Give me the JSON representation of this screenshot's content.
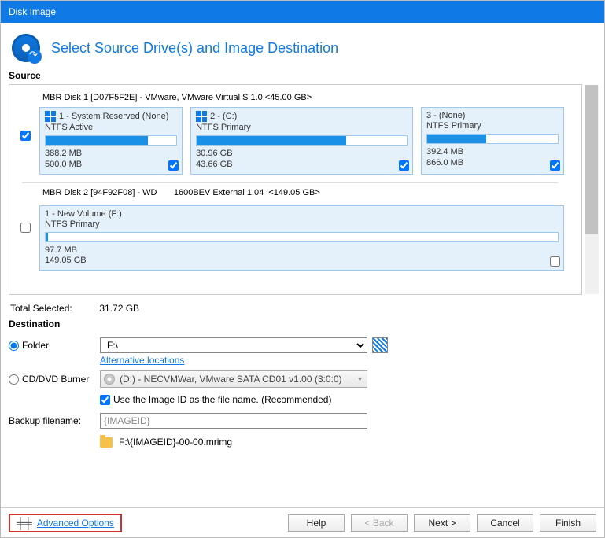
{
  "window": {
    "title": "Disk Image"
  },
  "header": {
    "title": "Select Source Drive(s) and Image Destination"
  },
  "source": {
    "label": "Source",
    "disk1": {
      "title": "MBR Disk 1 [D07F5F2E] - VMware,  VMware Virtual S 1.0  <45.00 GB>",
      "checked": true,
      "partitions": [
        {
          "name": "1 - System Reserved (None)",
          "type": "NTFS Active",
          "used": "388.2 MB",
          "total": "500.0 MB",
          "fill": 78,
          "checked": true,
          "winicon": true
        },
        {
          "name": "2 -  (C:)",
          "type": "NTFS Primary",
          "used": "30.96 GB",
          "total": "43.66 GB",
          "fill": 71,
          "checked": true,
          "winicon": true
        },
        {
          "name": "3 -  (None)",
          "type": "NTFS Primary",
          "used": "392.4 MB",
          "total": "866.0 MB",
          "fill": 45,
          "checked": true,
          "winicon": false
        }
      ]
    },
    "disk2": {
      "title": "MBR Disk 2 [94F92F08] - WD       1600BEV External 1.04  <149.05 GB>",
      "checked": false,
      "partition": {
        "name": "1 - New Volume (F:)",
        "type": "NTFS Primary",
        "used": "97.7 MB",
        "total": "149.05 GB",
        "fill": 0.1,
        "checked": false
      }
    }
  },
  "total": {
    "label": "Total Selected:",
    "value": "31.72 GB"
  },
  "destination": {
    "label": "Destination",
    "folder": {
      "label": "Folder",
      "value": "F:\\",
      "alt": "Alternative locations"
    },
    "burner": {
      "label": "CD/DVD Burner",
      "value": "(D:) - NECVMWar, VMware SATA CD01 v1.00 (3:0:0)"
    },
    "use_image_id": {
      "checked": true,
      "label": "Use the Image ID as the file name.  (Recommended)"
    },
    "filename": {
      "label": "Backup filename:",
      "value": "{IMAGEID}"
    },
    "resolved": "F:\\{IMAGEID}-00-00.mrimg"
  },
  "footer": {
    "advanced": "Advanced Options",
    "help": "Help",
    "back": "< Back",
    "next": "Next >",
    "cancel": "Cancel",
    "finish": "Finish"
  }
}
